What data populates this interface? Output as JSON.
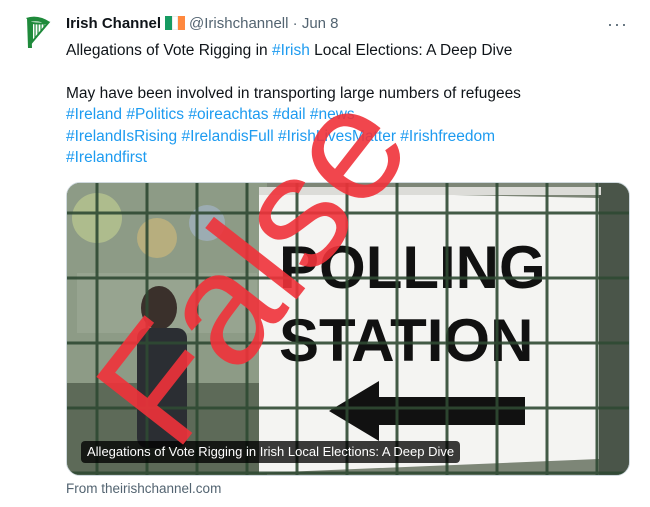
{
  "account": {
    "display_name": "Irish Channel",
    "handle": "@Irishchannell",
    "separator": "·",
    "date": "Jun 8",
    "avatar_icon": "irish-harp-icon",
    "flag_icon": "ireland-flag-icon"
  },
  "more_label": "···",
  "post": {
    "headline_prefix": "Allegations of Vote Rigging in ",
    "headline_tag": "#Irish",
    "headline_suffix": " Local Elections: A Deep Dive",
    "body_text": "May have been involved in transporting large numbers of refugees",
    "hashtags_line1": [
      "#Ireland",
      "#Politics",
      "#oireachtas",
      "#dail",
      "#news"
    ],
    "hashtags_line2": [
      "#IrelandIsRising",
      "#IrelandisFull",
      "#IrishLivesMatter",
      "#Irishfreedom"
    ],
    "hashtags_line3": [
      "#Irelandfirst"
    ]
  },
  "card": {
    "sign_line1": "POLLING",
    "sign_line2": "STATION",
    "title": "Allegations of Vote Rigging in Irish Local Elections: A Deep Dive",
    "source": "From theirishchannel.com"
  },
  "stamp": {
    "text": "False",
    "color": "#f0323a"
  },
  "colors": {
    "link": "#1d9bf0",
    "muted": "#536471",
    "avatar_green": "#1f8a3b"
  }
}
